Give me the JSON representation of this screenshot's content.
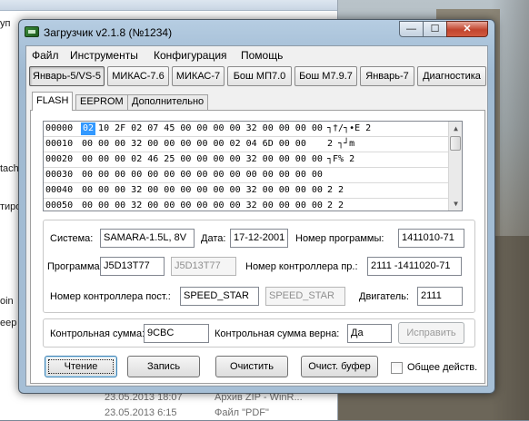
{
  "background": {
    "left_snippets": [
      "уп",
      "tach",
      "тиро",
      "oin",
      "eep"
    ],
    "file_rows": [
      {
        "date": "23.05.2013 18:07",
        "type": "Архив ZIP - WinR..."
      },
      {
        "date": "23.05.2013 6:15",
        "type": "Файл \"PDF\""
      }
    ]
  },
  "window": {
    "title": "Загрузчик v2.1.8 (№1234)",
    "controls": {
      "minimize": "—",
      "maximize": "☐",
      "close": "✕"
    }
  },
  "menu": [
    "Файл",
    "Инструменты",
    "Конфигурация",
    "Помощь"
  ],
  "ecu_buttons": [
    {
      "label": "Январь-5/VS-5",
      "active": true
    },
    {
      "label": "МИКАС-7.6"
    },
    {
      "label": "МИКАС-7"
    },
    {
      "label": "Бош МП7.0"
    },
    {
      "label": "Бош М7.9.7"
    },
    {
      "label": "Январь-7"
    },
    {
      "label": "Диагностика"
    }
  ],
  "tabs": [
    {
      "label": "FLASH",
      "active": true
    },
    {
      "label": "EEPROM"
    },
    {
      "label": "Дополнительно"
    }
  ],
  "hex": {
    "selected_byte": "02",
    "rows": [
      {
        "addr": "00000",
        "bytes": "02 10 2F 02 07 45 00 00 00 00 32 00 00 00 00",
        "ascii": "┐†/┐•E     2"
      },
      {
        "addr": "00010",
        "bytes": "00 00 00 32 00 00 00 00 00 02 04 6D 00 00",
        "ascii": "    2     ┐┘m"
      },
      {
        "addr": "00020",
        "bytes": "00 00 00 02 46 25 00 00 00 00 32 00 00 00 00",
        "ascii": "   ┐F%     2"
      },
      {
        "addr": "00030",
        "bytes": "00 00 00 00 00 00 00 00 00 00 00 00 00 00 00",
        "ascii": ""
      },
      {
        "addr": "00040",
        "bytes": "00 00 00 32 00 00 00 00 00 00 32 00 00 00 00",
        "ascii": "    2      2"
      },
      {
        "addr": "00050",
        "bytes": "00 00 00 32 00 00 00 00 00 00 32 00 00 00 00",
        "ascii": "    2      2"
      }
    ]
  },
  "info": {
    "system_label": "Система:",
    "system_value": "SAMARA-1.5L, 8V",
    "date_label": "Дата:",
    "date_value": "17-12-2001",
    "program_number_label": "Номер программы:",
    "program_number_value": "1411010-71",
    "program_label": "Программа:",
    "program_value": "J5D13T77",
    "program_value_ghost": "J5D13T77",
    "controller_number_label": "Номер контроллера пр.:",
    "controller_number_value": "2111 -1411020-71",
    "supplier_label": "Номер контроллера пост.:",
    "supplier_value": "SPEED_STAR",
    "supplier_value_ghost": "SPEED_STAR",
    "engine_label": "Двигатель:",
    "engine_value": "2111"
  },
  "checksum": {
    "label": "Контрольная сумма:",
    "value": "9CBC",
    "valid_label": "Контрольная сумма верна:",
    "valid_value": "Да",
    "fix_button": "Исправить"
  },
  "actions": {
    "read": "Чтение",
    "write": "Запись",
    "clear": "Очистить",
    "clear_buffer": "Очист. буфер",
    "shared_label": "Общее действ.",
    "shared_checked": false
  }
}
